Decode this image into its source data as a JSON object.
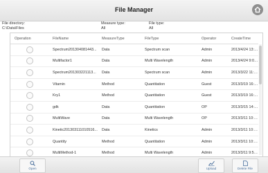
{
  "window": {
    "title": "File Manager"
  },
  "filters": {
    "file_directory": {
      "label": "File directory:",
      "value": "C:\\Data\\Files"
    },
    "measure_type": {
      "label": "Measure type:",
      "value": "All"
    },
    "file_type": {
      "label": "File type:",
      "value": "All"
    }
  },
  "table": {
    "headers": [
      "Operation",
      "FileName",
      "MeasureType",
      "FileType",
      "Operator",
      "CreateTime"
    ],
    "rows": [
      {
        "filename": "Spectrum201304081443...",
        "measure_type": "Data",
        "file_type": "Spectrum scan",
        "operator": "Admin",
        "create_time": "2013/4/24 13:48:00"
      },
      {
        "filename": "Multifactor1",
        "measure_type": "Data",
        "file_type": "Multi Wavelength",
        "operator": "Admin",
        "create_time": "2013/4/24 9:03:56"
      },
      {
        "filename": "Spectrum201303221113...",
        "measure_type": "Data",
        "file_type": "Spectrum scan",
        "operator": "Admin",
        "create_time": "2013/3/22 11:13:32"
      },
      {
        "filename": "Vitamin",
        "measure_type": "Method",
        "file_type": "Quantitation",
        "operator": "Guest",
        "create_time": "2013/3/19 16:30:57"
      },
      {
        "filename": "Kry1",
        "measure_type": "Method",
        "file_type": "Quantitation",
        "operator": "Guest",
        "create_time": "2013/3/19 16:10:00"
      },
      {
        "filename": "gdk",
        "measure_type": "Data",
        "file_type": "Quantitation",
        "operator": "OP",
        "create_time": "2013/3/15 14:31:17"
      },
      {
        "filename": "MultiWave",
        "measure_type": "Data",
        "file_type": "Multi Wavelength",
        "operator": "OP",
        "create_time": "2013/3/11 10:20:08"
      },
      {
        "filename": "Kinetic201303111010516...",
        "measure_type": "Data",
        "file_type": "Kinetics",
        "operator": "Admin",
        "create_time": "2013/3/11 10:10:50"
      },
      {
        "filename": "Quantity",
        "measure_type": "Method",
        "file_type": "Quantitation",
        "operator": "Admin",
        "create_time": "2013/3/11 10:08:51"
      },
      {
        "filename": "MultiMethod-1",
        "measure_type": "Method",
        "file_type": "Multi Wavelength",
        "operator": "Admin",
        "create_time": "2013/3/11 9:57:01"
      }
    ]
  },
  "footer": {
    "open_label": "Open",
    "upload_label": "Upload",
    "delete_label": "Delete File"
  },
  "colors": {
    "accent": "#4a6f9c"
  }
}
